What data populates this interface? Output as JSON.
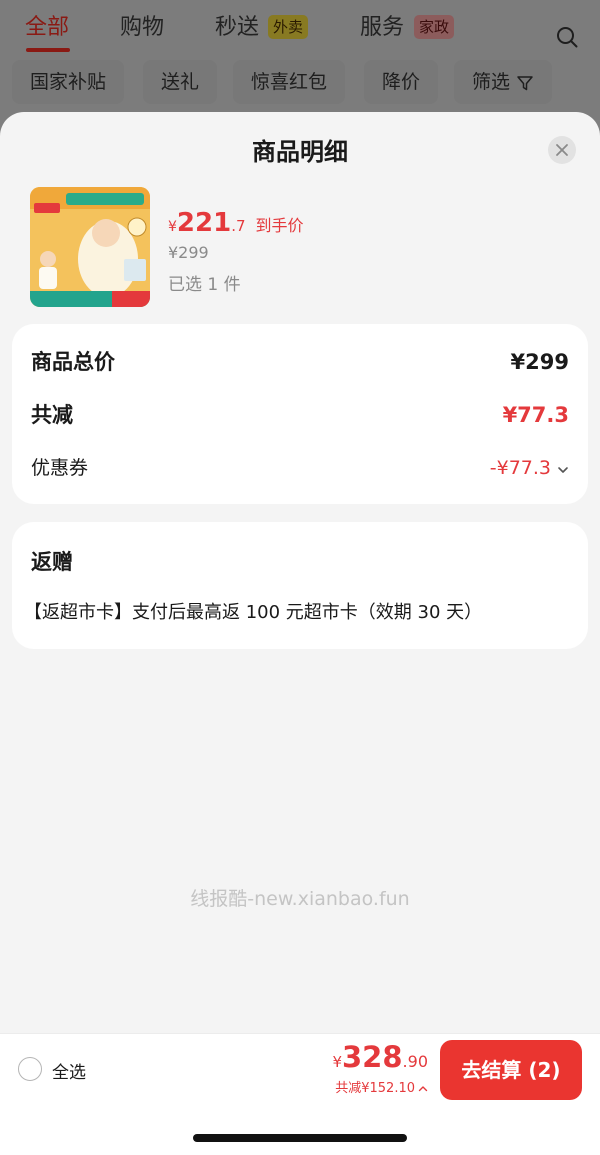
{
  "nav": {
    "tabs": [
      {
        "label": "全部"
      },
      {
        "label": "购物"
      },
      {
        "label": "秒送"
      },
      {
        "label": "服务"
      }
    ],
    "tab_badges": [
      "外卖",
      "家政"
    ],
    "filters": [
      "国家补贴",
      "送礼",
      "惊喜红包",
      "降价",
      "筛选"
    ]
  },
  "sheet": {
    "title": "商品明细",
    "product": {
      "image_icon": "product-thumbnail",
      "currency": "¥",
      "price_int": "221",
      "price_dec": ".7",
      "price_tag": "到手价",
      "original_price": "¥299",
      "selected_count": "已选 1 件"
    },
    "summary": {
      "total_label": "商品总价",
      "total_value": "¥299",
      "reduce_label": "共减",
      "reduce_value": "¥77.3",
      "coupon_label": "优惠券",
      "coupon_value": "-¥77.3"
    },
    "gift": {
      "title": "返赠",
      "desc": "【返超市卡】支付后最高返 100 元超市卡（效期 30 天）"
    },
    "watermark": "线报酷-new.xianbao.fun"
  },
  "bottom_bar": {
    "select_all": "全选",
    "currency": "¥",
    "total_int": "328",
    "total_dec": ".90",
    "saved": "共减¥152.10",
    "checkout": "去结算 (2)"
  },
  "colors": {
    "accent_red": "#e4393c",
    "checkout_red": "#ea3530",
    "sheet_bg": "#f4f4f4"
  }
}
